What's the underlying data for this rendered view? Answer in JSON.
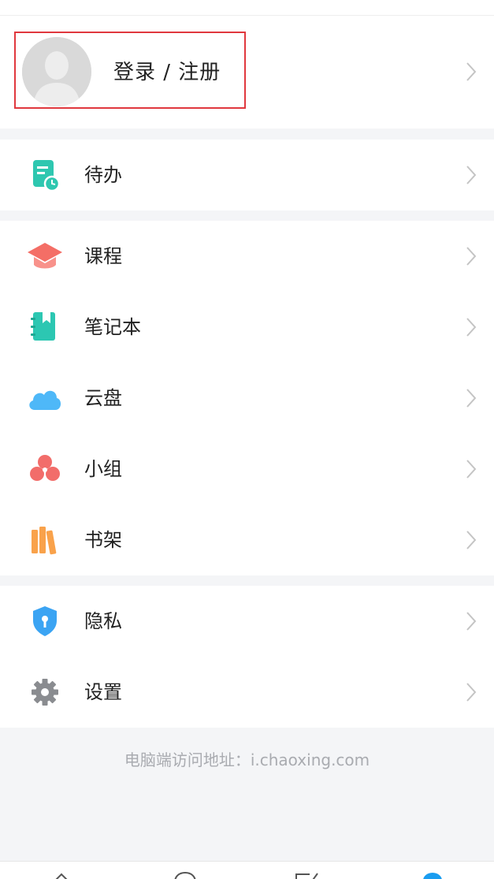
{
  "profile": {
    "login_label": "登录 / 注册"
  },
  "todo": {
    "label": "待办",
    "icon": "todo-icon",
    "color": "#2ec7b0"
  },
  "menu": [
    {
      "label": "课程",
      "icon": "course-cap-icon",
      "color": "#f46e66"
    },
    {
      "label": "笔记本",
      "icon": "notebook-icon",
      "color": "#2cc7b2"
    },
    {
      "label": "云盘",
      "icon": "cloud-icon",
      "color": "#4eb8f8"
    },
    {
      "label": "小组",
      "icon": "group-icon",
      "color": "#f26d6a"
    },
    {
      "label": "书架",
      "icon": "bookshelf-icon",
      "color": "#f9a24b"
    }
  ],
  "settings_menu": [
    {
      "label": "隐私",
      "icon": "privacy-shield-icon",
      "color": "#3ba4f3"
    },
    {
      "label": "设置",
      "icon": "gear-icon",
      "color": "#8a8c90"
    }
  ],
  "footer": {
    "text": "电脑端访问地址：i.chaoxing.com"
  },
  "colors": {
    "accent_tab": "#1a9df0",
    "highlight_box": "#e0383e"
  }
}
